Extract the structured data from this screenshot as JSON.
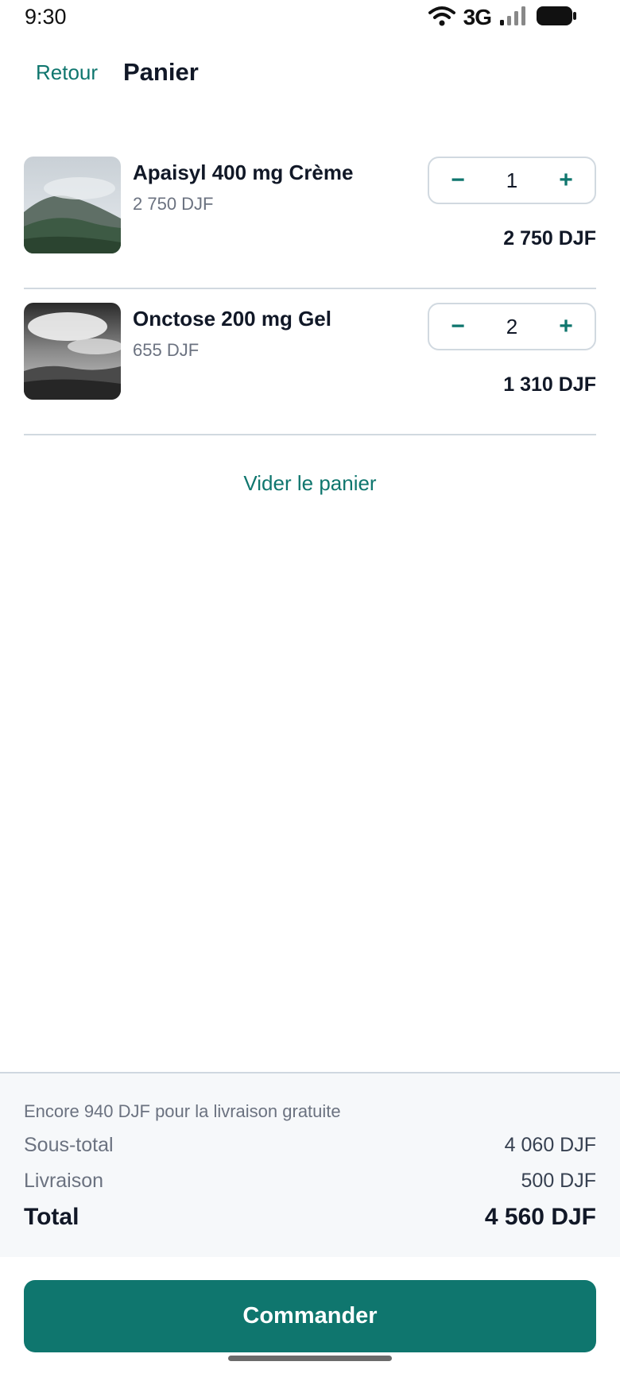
{
  "status_bar": {
    "time": "9:30",
    "network": "3G",
    "icons": [
      "wifi-icon",
      "signal-icon",
      "battery-icon"
    ]
  },
  "header": {
    "back_label": "Retour",
    "title": "Panier"
  },
  "cart": {
    "items": [
      {
        "name": "Apaisyl 400 mg Crème",
        "unit_price": "2 750 DJF",
        "quantity": "1",
        "line_total": "2 750 DJF",
        "thumbnail": "misty-mountain-photo"
      },
      {
        "name": "Onctose 200 mg Gel",
        "unit_price": "655 DJF",
        "quantity": "2",
        "line_total": "1 310 DJF",
        "thumbnail": "bw-clouds-mountain-photo"
      }
    ],
    "decrement_symbol": "−",
    "increment_symbol": "+",
    "clear_label": "Vider le panier"
  },
  "summary": {
    "free_shipping_note": "Encore 940 DJF pour la livraison gratuite",
    "subtotal_label": "Sous-total",
    "subtotal_value": "4 060 DJF",
    "shipping_label": "Livraison",
    "shipping_value": "500 DJF",
    "total_label": "Total",
    "total_value": "4 560 DJF"
  },
  "cta": {
    "order_label": "Commander"
  },
  "colors": {
    "accent": "#0f766e",
    "divider": "#d1d9e0",
    "summary_bg": "#f6f8fa"
  }
}
